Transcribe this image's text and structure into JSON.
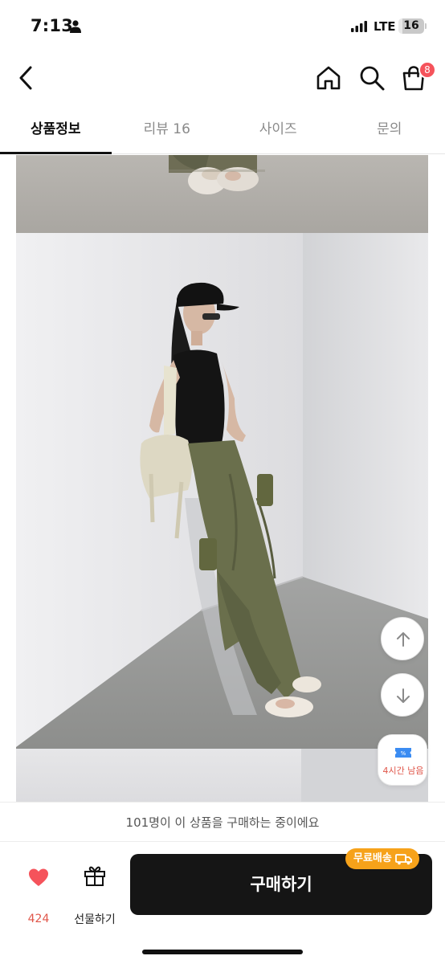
{
  "status_bar": {
    "time": "7:13",
    "network": "LTE",
    "battery": "16",
    "battery_level": 0.16
  },
  "nav": {
    "cart_badge": "8"
  },
  "tabs": [
    {
      "label": "상품정보",
      "active": true
    },
    {
      "label": "리뷰 16",
      "active": false
    },
    {
      "label": "사이즈",
      "active": false
    },
    {
      "label": "문의",
      "active": false
    }
  ],
  "floating": {
    "coupon_text": "4시간 남음"
  },
  "buyers_bar": {
    "text": "101명이 이 상품을 구매하는 중이에요"
  },
  "bottom_bar": {
    "like_count": "424",
    "gift_label": "선물하기",
    "buy_label": "구매하기",
    "shipping_badge": "무료배송"
  },
  "colors": {
    "accent": "#f5535b",
    "like": "#e0564a",
    "buy_button": "#151515",
    "shipping_badge": "#f6a21a"
  }
}
